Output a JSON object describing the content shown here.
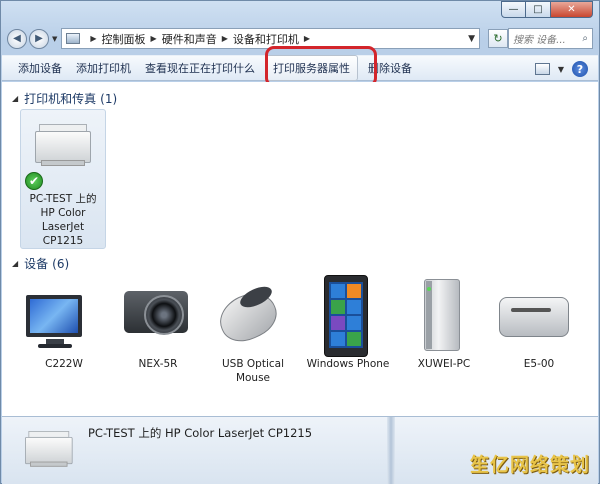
{
  "window": {
    "caption_buttons": {
      "minimize": "—",
      "maximize": "□",
      "close": "✕"
    }
  },
  "address_bar": {
    "back_icon": "back-arrow-icon",
    "forward_icon": "forward-arrow-icon",
    "breadcrumbs": [
      "控制面板",
      "硬件和声音",
      "设备和打印机"
    ],
    "search_placeholder": "搜索 设备..."
  },
  "command_bar": {
    "items": [
      "添加设备",
      "添加打印机",
      "查看现在正在打印什么",
      "打印服务器属性",
      "删除设备"
    ],
    "highlight_color": "#d3252b"
  },
  "groups": {
    "printers": {
      "title": "打印机和传真",
      "count": "(1)"
    },
    "devices": {
      "title": "设备",
      "count": "(6)"
    }
  },
  "printer_item": {
    "label_lines": [
      "PC-TEST 上的",
      "HP Color",
      "LaserJet",
      "CP1215"
    ],
    "default_badge": "✔"
  },
  "devices": [
    {
      "label": "C222W",
      "icon": "monitor-icon"
    },
    {
      "label": "NEX-5R",
      "icon": "camera-icon"
    },
    {
      "label_lines": [
        "USB Optical",
        "Mouse"
      ],
      "icon": "mouse-icon"
    },
    {
      "label": "Windows Phone",
      "icon": "phone-icon"
    },
    {
      "label": "XUWEI-PC",
      "icon": "computer-tower-icon"
    },
    {
      "label": "E5-00",
      "icon": "external-drive-icon"
    }
  ],
  "details_pane": {
    "title": "PC-TEST 上的 HP Color LaserJet CP1215"
  },
  "watermark": "笙亿网络策划"
}
